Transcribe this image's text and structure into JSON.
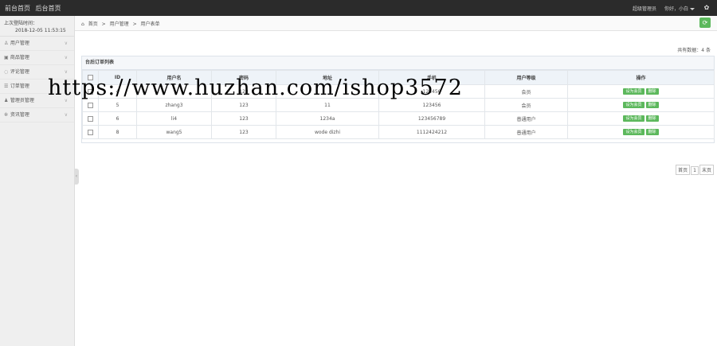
{
  "topbar": {
    "front_home": "前台首页",
    "back_home": "后台首页",
    "role": "超级管理员",
    "greeting": "你好，小白"
  },
  "sidebar": {
    "last_login_label": "上次登陆时间：",
    "last_login_time": "2018-12-05 11:53:15",
    "items": [
      {
        "label": "用户管理"
      },
      {
        "label": "商品管理"
      },
      {
        "label": "评论管理"
      },
      {
        "label": "订单管理"
      },
      {
        "label": "管理员管理"
      },
      {
        "label": "资讯管理"
      }
    ]
  },
  "breadcrumb": {
    "home": "首页",
    "sep": ">",
    "level1": "用户管理",
    "level2": "用户表单"
  },
  "total_label": "共有数据：4 条",
  "table": {
    "title": "台后订单列表",
    "headers": [
      "ID",
      "用户名",
      "密码",
      "地址",
      "手机",
      "用户等级",
      "操作"
    ],
    "rows": [
      {
        "id": "4",
        "username": "",
        "password": "123",
        "address": "",
        "phone": "123456",
        "level": "会员",
        "actions": [
          "设为会员",
          "删除"
        ]
      },
      {
        "id": "5",
        "username": "zhang3",
        "password": "123",
        "address": "11",
        "phone": "123456",
        "level": "会员",
        "actions": [
          "设为会员",
          "删除"
        ]
      },
      {
        "id": "6",
        "username": "li4",
        "password": "123",
        "address": "1234a",
        "phone": "123456789",
        "level": "普通用户",
        "actions": [
          "设为会员",
          "删除"
        ]
      },
      {
        "id": "8",
        "username": "wang5",
        "password": "123",
        "address": "wode dizhi",
        "phone": "1112424212",
        "level": "普通用户",
        "actions": [
          "设为会员",
          "删除"
        ]
      }
    ]
  },
  "pager": {
    "first": "首页",
    "current": "1",
    "last": "末页"
  },
  "watermark": "https://www.huzhan.com/ishop3572"
}
